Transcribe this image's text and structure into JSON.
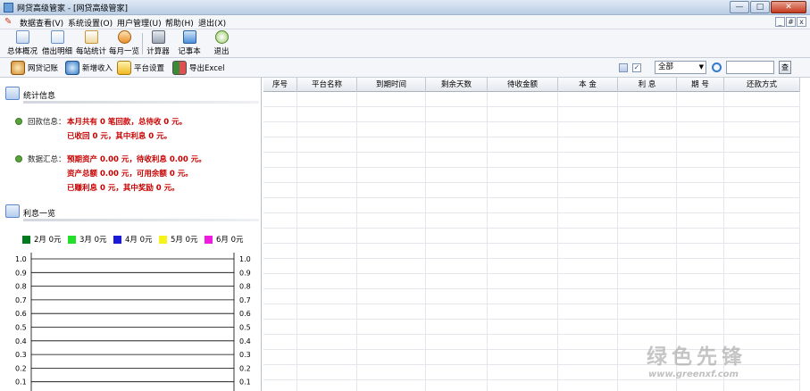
{
  "window": {
    "title": "网贷高级管家 - [网贷高级管家]"
  },
  "menubar": {
    "items": [
      "数据查看(V)",
      "系统设置(O)",
      "用户管理(U)",
      "帮助(H)",
      "退出(X)"
    ],
    "mdi_buttons": [
      "_",
      "#",
      "x"
    ]
  },
  "toolbar": {
    "buttons": [
      "总体概况",
      "借出明细",
      "每站统计",
      "每月一览",
      "计算器",
      "记事本",
      "退出"
    ]
  },
  "toolbar2": {
    "buttons": [
      "网贷记账",
      "新增收入",
      "平台设置",
      "导出Excel"
    ],
    "filter_value": "全部",
    "search_value": "",
    "go_label": "查"
  },
  "stats": {
    "title": "统计信息",
    "repay_label": "回款信息：",
    "repay_line1": "本月共有 0 笔回款，总待收 0 元。",
    "repay_line2": "已收回 0 元，其中利息 0 元。",
    "summary_label": "数据汇总：",
    "summary_line1": "预期资产 0.00 元，待收利息 0.00 元。",
    "summary_line2": "资产总额 0.00 元，可用余额 0 元。",
    "summary_line3": "已赚利息 0 元，其中奖励 0 元。"
  },
  "interest": {
    "title": "利息一览"
  },
  "chart_data": {
    "type": "line",
    "categories": [
      "2月",
      "3月",
      "4月",
      "5月",
      "6月"
    ],
    "series": [
      {
        "name": "2月 0元",
        "color": "#007a1f",
        "values": [
          0
        ]
      },
      {
        "name": "3月 0元",
        "color": "#22e02a",
        "values": [
          0
        ]
      },
      {
        "name": "4月 0元",
        "color": "#1a1ad8",
        "values": [
          0
        ]
      },
      {
        "name": "5月 0元",
        "color": "#f4f41a",
        "values": [
          0
        ]
      },
      {
        "name": "6月 0元",
        "color": "#f01ae0",
        "values": [
          0
        ]
      }
    ],
    "yticks": [
      "1.0",
      "0.9",
      "0.8",
      "0.7",
      "0.6",
      "0.5",
      "0.4",
      "0.3",
      "0.2",
      "0.1"
    ],
    "ylim": [
      0,
      1
    ],
    "grid": true,
    "legend": "top"
  },
  "table": {
    "columns": [
      "序号",
      "平台名称",
      "到期时间",
      "剩余天数",
      "待收金额",
      "本 金",
      "利 息",
      "期 号",
      "还款方式"
    ],
    "rows": []
  },
  "watermark": {
    "big": "绿色先锋",
    "small": "www.greenxf.com"
  },
  "colors": {
    "stat_text": "#c80000",
    "dot": "#5aa23a"
  }
}
